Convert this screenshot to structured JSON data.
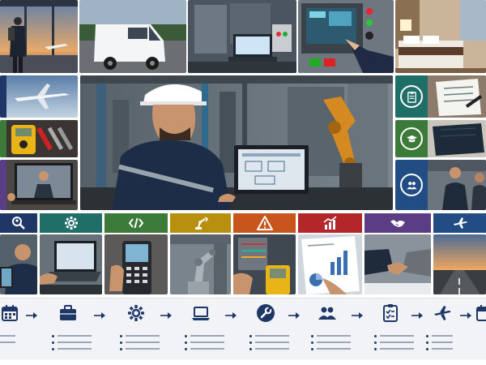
{
  "scene": "collage",
  "colors": {
    "navy": "#1e3766",
    "teal": "#1f6e68",
    "green": "#3c7a3a",
    "mustard": "#b8900f",
    "orange": "#c8561c",
    "red": "#b3272a",
    "purple": "#5b3d86",
    "steel_blue": "#224c84"
  },
  "top_row_scenes": [
    "traveler-at-airport",
    "white-van",
    "control-panel-laptop",
    "operator-touchscreen",
    "hotel-room"
  ],
  "left_column_scenes": [
    "airplane-sky",
    "multimeter-tools",
    "video-call"
  ],
  "main_scene": "engineer-laptop-robotic-line",
  "right_column_icons": [
    "clipboard-icon",
    "graduation-cap-icon",
    "team-icon"
  ],
  "category_icons": [
    "search-user-icon",
    "gear-icon",
    "code-icon",
    "robot-arm-icon",
    "warning-icon",
    "chart-up-icon",
    "handshake-icon",
    "airplane-icon"
  ],
  "timeline_icons": [
    "calendar-icon",
    "briefcase-icon",
    "gear-icon",
    "laptop-icon",
    "wrench-icon",
    "team-icon",
    "checklist-icon",
    "airplane-icon",
    "calendar-icon"
  ]
}
